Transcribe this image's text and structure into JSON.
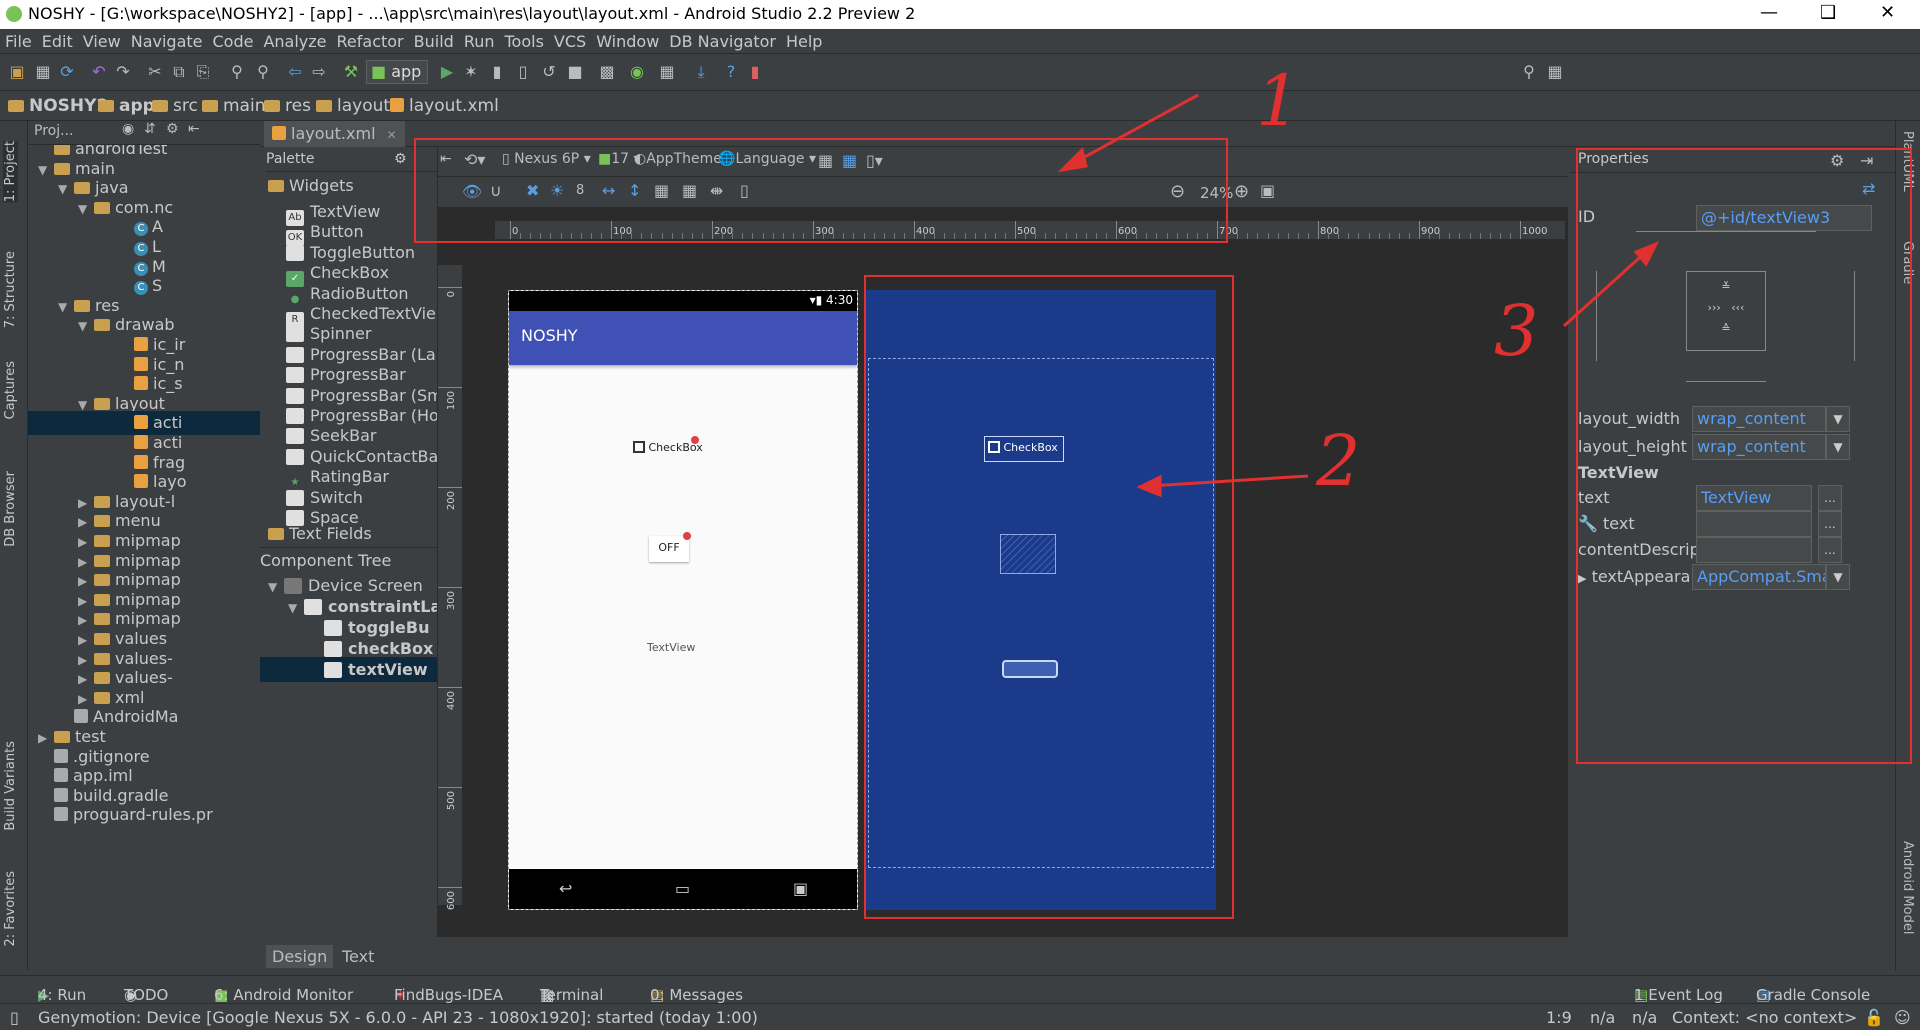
{
  "window": {
    "title": "NOSHY - [G:\\workspace\\NOSHY2] - [app] - ...\\app\\src\\main\\res\\layout\\layout.xml - Android Studio 2.2 Preview 2"
  },
  "menu": [
    "File",
    "Edit",
    "View",
    "Navigate",
    "Code",
    "Analyze",
    "Refactor",
    "Build",
    "Run",
    "Tools",
    "VCS",
    "Window",
    "DB Navigator",
    "Help"
  ],
  "toolbar": {
    "run_config": "app"
  },
  "breadcrumb": [
    "NOSHY2",
    "app",
    "src",
    "main",
    "res",
    "layout",
    "layout.xml"
  ],
  "left_tabs": [
    "1: Project",
    "7: Structure",
    "Captures",
    "DB Browser",
    "Build Variants",
    "2: Favorites"
  ],
  "project": {
    "header": "Proj...",
    "rows": [
      {
        "label": "androidTest",
        "indent": 4,
        "arrow": "",
        "icon": "folder"
      },
      {
        "label": "main",
        "indent": 4,
        "arrow": "▼",
        "icon": "folder"
      },
      {
        "label": "java",
        "indent": 5,
        "arrow": "▼",
        "icon": "folder"
      },
      {
        "label": "com.nc",
        "indent": 6,
        "arrow": "▼",
        "icon": "package"
      },
      {
        "label": "A",
        "indent": 8,
        "arrow": "",
        "icon": "class"
      },
      {
        "label": "L",
        "indent": 8,
        "arrow": "",
        "icon": "class"
      },
      {
        "label": "M",
        "indent": 8,
        "arrow": "",
        "icon": "class"
      },
      {
        "label": "S",
        "indent": 8,
        "arrow": "",
        "icon": "class"
      },
      {
        "label": "res",
        "indent": 5,
        "arrow": "▼",
        "icon": "folder"
      },
      {
        "label": "drawab",
        "indent": 6,
        "arrow": "▼",
        "icon": "folder"
      },
      {
        "label": "ic_ir",
        "indent": 8,
        "arrow": "",
        "icon": "xml"
      },
      {
        "label": "ic_n",
        "indent": 8,
        "arrow": "",
        "icon": "xml"
      },
      {
        "label": "ic_s",
        "indent": 8,
        "arrow": "",
        "icon": "xml"
      },
      {
        "label": "layout",
        "indent": 6,
        "arrow": "▼",
        "icon": "folder"
      },
      {
        "label": "acti",
        "indent": 8,
        "arrow": "",
        "icon": "xml"
      },
      {
        "label": "acti",
        "indent": 8,
        "arrow": "",
        "icon": "xml"
      },
      {
        "label": "frag",
        "indent": 8,
        "arrow": "",
        "icon": "xml"
      },
      {
        "label": "layo",
        "indent": 8,
        "arrow": "",
        "icon": "xml"
      },
      {
        "label": "layout-l",
        "indent": 6,
        "arrow": "▶",
        "icon": "folder"
      },
      {
        "label": "menu",
        "indent": 6,
        "arrow": "▶",
        "icon": "folder"
      },
      {
        "label": "mipmap",
        "indent": 6,
        "arrow": "▶",
        "icon": "folder"
      },
      {
        "label": "mipmap",
        "indent": 6,
        "arrow": "▶",
        "icon": "folder"
      },
      {
        "label": "mipmap",
        "indent": 6,
        "arrow": "▶",
        "icon": "folder"
      },
      {
        "label": "mipmap",
        "indent": 6,
        "arrow": "▶",
        "icon": "folder"
      },
      {
        "label": "mipmap",
        "indent": 6,
        "arrow": "▶",
        "icon": "folder"
      },
      {
        "label": "values",
        "indent": 6,
        "arrow": "▶",
        "icon": "folder"
      },
      {
        "label": "values-",
        "indent": 6,
        "arrow": "▶",
        "icon": "folder"
      },
      {
        "label": "values-",
        "indent": 6,
        "arrow": "▶",
        "icon": "folder"
      },
      {
        "label": "xml",
        "indent": 6,
        "arrow": "▶",
        "icon": "folder"
      },
      {
        "label": "AndroidMa",
        "indent": 5,
        "arrow": "",
        "icon": "manifest"
      },
      {
        "label": "test",
        "indent": 4,
        "arrow": "▶",
        "icon": "folder"
      },
      {
        "label": ".gitignore",
        "indent": 4,
        "arrow": "",
        "icon": "file"
      },
      {
        "label": "app.iml",
        "indent": 4,
        "arrow": "",
        "icon": "file"
      },
      {
        "label": "build.gradle",
        "indent": 4,
        "arrow": "",
        "icon": "gradle"
      },
      {
        "label": "proguard-rules.pr",
        "indent": 4,
        "arrow": "",
        "icon": "file"
      }
    ],
    "selected_index": 14
  },
  "editor": {
    "tab": "layout.xml"
  },
  "palette": {
    "title": "Palette",
    "widgets_group": "Widgets",
    "widgets": [
      {
        "label": "TextView",
        "icon": "Ab"
      },
      {
        "label": "Button",
        "icon": "OK"
      },
      {
        "label": "ToggleButton",
        "icon": ""
      },
      {
        "label": "CheckBox",
        "icon": "✓"
      },
      {
        "label": "RadioButton",
        "icon": "●"
      },
      {
        "label": "CheckedTextVie",
        "icon": "R"
      },
      {
        "label": "Spinner",
        "icon": ""
      },
      {
        "label": "ProgressBar (Lar",
        "icon": ""
      },
      {
        "label": "ProgressBar",
        "icon": ""
      },
      {
        "label": "ProgressBar (Sm",
        "icon": ""
      },
      {
        "label": "ProgressBar (Ho",
        "icon": ""
      },
      {
        "label": "SeekBar",
        "icon": ""
      },
      {
        "label": "QuickContactBad",
        "icon": ""
      },
      {
        "label": "RatingBar",
        "icon": "★"
      },
      {
        "label": "Switch",
        "icon": ""
      },
      {
        "label": "Space",
        "icon": ""
      }
    ],
    "text_fields_group": "Text Fields"
  },
  "component_tree": {
    "title": "Component Tree",
    "items": [
      {
        "label": "Device Screen",
        "indent": 0
      },
      {
        "label": "constraintLa",
        "indent": 1
      },
      {
        "label": "toggleBu",
        "indent": 2
      },
      {
        "label": "checkBox",
        "indent": 2
      },
      {
        "label": "textView",
        "indent": 2
      }
    ]
  },
  "design_toolbar": {
    "device": "Nexus 6P",
    "api": "17",
    "theme": "AppTheme",
    "language": "Language",
    "margin": "8",
    "zoom": "24%"
  },
  "ruler": {
    "h_ticks": [
      "0",
      "100",
      "200",
      "300",
      "400",
      "500",
      "600",
      "700",
      "800",
      "900",
      "1000"
    ],
    "v_ticks": [
      "0",
      "100",
      "200",
      "300",
      "400",
      "500",
      "600"
    ]
  },
  "phone": {
    "time": "4:30",
    "app_title": "NOSHY",
    "checkbox": "CheckBox",
    "toggle": "OFF",
    "textview": "TextView",
    "appbar_color": "#3f51b5"
  },
  "blueprint": {
    "checkbox": "CheckBox",
    "color": "#1c3a8a"
  },
  "design_tabs": [
    "Design",
    "Text"
  ],
  "properties": {
    "title": "Properties",
    "id_label": "ID",
    "id_value": "@+id/textView3",
    "layout_width_label": "layout_width",
    "layout_width_value": "wrap_content",
    "layout_height_label": "layout_height",
    "layout_height_value": "wrap_content",
    "section": "TextView",
    "text_label": "text",
    "text_value": "TextView",
    "tools_text_label": "text",
    "content_desc_label": "contentDescrip...",
    "text_appearance_label": "textAppeara...",
    "text_appearance_value": "AppCompat.Small",
    "more": "..."
  },
  "right_tabs": [
    "PlantUML",
    "Gradle",
    "Android Model"
  ],
  "tool_windows": [
    {
      "label": "4: Run"
    },
    {
      "label": "TODO"
    },
    {
      "label": "6: Android Monitor"
    },
    {
      "label": "FindBugs-IDEA"
    },
    {
      "label": "Terminal"
    },
    {
      "label": "0: Messages"
    },
    {
      "label": "1 Event Log"
    },
    {
      "label": "Gradle Console"
    }
  ],
  "status": {
    "message": "Genymotion: Device [Google Nexus 5X - 6.0.0 - API 23 - 1080x1920]: started (today 1:00)",
    "position": "1:9",
    "na1": "n/a",
    "na2": "n/a",
    "context": "Context: <no context>"
  },
  "annotations": [
    "1",
    "2",
    "3"
  ],
  "colors": {
    "accent_red": "#e03030",
    "link_blue": "#589df6"
  }
}
